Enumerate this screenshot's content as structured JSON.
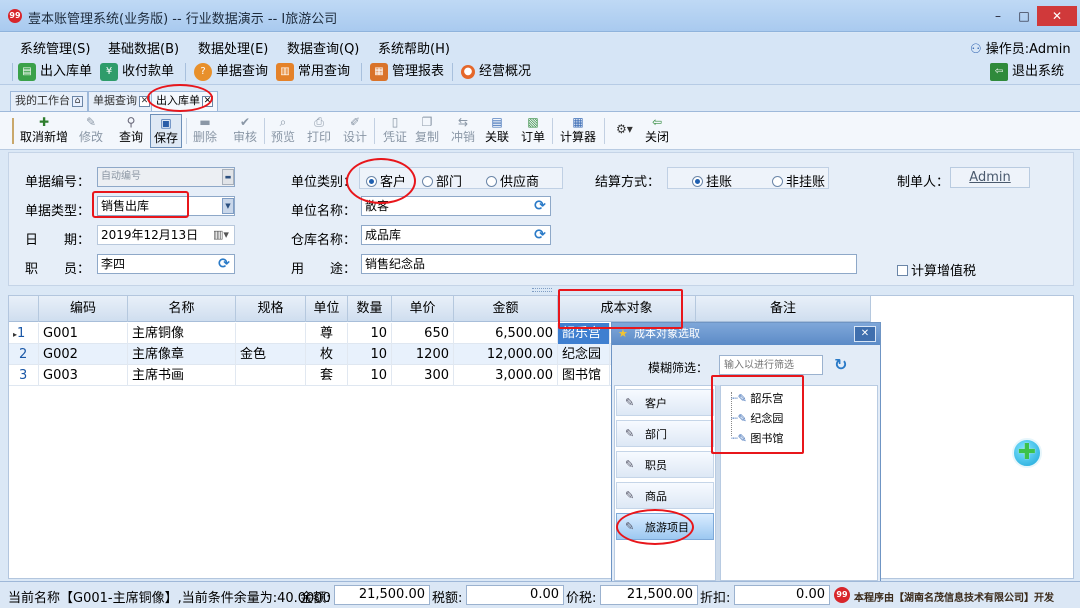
{
  "window": {
    "title": "壹本账管理系统(业务版) -- 行业数据演示 -- I旅游公司",
    "min_label": "–",
    "max_label": "□",
    "close_label": "✕"
  },
  "menu": {
    "items": [
      "系统管理(S)",
      "基础数据(B)",
      "数据处理(E)",
      "数据查询(Q)",
      "系统帮助(H)"
    ],
    "operator": "操作员:Admin"
  },
  "toolbar1": {
    "items": [
      "出入库单",
      "收付款单",
      "单据查询",
      "常用查询",
      "管理报表",
      "经营概况"
    ],
    "exit": "退出系统"
  },
  "tabs": [
    "我的工作台",
    "单据查询",
    "出入库单"
  ],
  "toolbar2": {
    "items": [
      "取消新增",
      "修改",
      "查询",
      "保存",
      "删除",
      "审核",
      "预览",
      "打印",
      "设计",
      "凭证",
      "复制",
      "冲销",
      "关联",
      "订单",
      "计算器",
      "",
      "关闭"
    ]
  },
  "form": {
    "doc_no_label": "单据编号：",
    "doc_no_placeholder": "自动编号",
    "doc_type_label": "单据类型：",
    "doc_type_value": "销售出库",
    "date_label": "日　　期：",
    "date_value": "2019年12月13日",
    "staff_label": "职　　员：",
    "staff_value": "李四",
    "unit_type_label": "单位类别：",
    "unit_types": [
      "客户",
      "部门",
      "供应商"
    ],
    "unit_name_label": "单位名称：",
    "unit_name_value": "散客",
    "warehouse_label": "仓库名称：",
    "warehouse_value": "成品库",
    "purpose_label": "用　　途：",
    "purpose_value": "销售纪念品",
    "settle_label": "结算方式：",
    "settle_options": [
      "挂账",
      "非挂账"
    ],
    "maker_label": "制单人：",
    "maker_value": "Admin",
    "vat_label": "计算增值税"
  },
  "grid": {
    "headers": [
      "编码",
      "名称",
      "规格",
      "单位",
      "数量",
      "单价",
      "金额",
      "成本对象",
      "备注"
    ],
    "rows": [
      {
        "no": "1",
        "code": "G001",
        "name": "主席铜像",
        "spec": "",
        "unit": "尊",
        "qty": "10",
        "price": "650",
        "amount": "6,500.00",
        "cost": "韶乐宫",
        "note": ""
      },
      {
        "no": "2",
        "code": "G002",
        "name": "主席像章",
        "spec": "金色",
        "unit": "枚",
        "qty": "10",
        "price": "1200",
        "amount": "12,000.00",
        "cost": "纪念园",
        "note": ""
      },
      {
        "no": "3",
        "code": "G003",
        "name": "主席书画",
        "spec": "",
        "unit": "套",
        "qty": "10",
        "price": "300",
        "amount": "3,000.00",
        "cost": "图书馆",
        "note": ""
      }
    ]
  },
  "popup": {
    "title": "成本对象选取",
    "filter_label": "模糊筛选：",
    "filter_placeholder": "输入以进行筛选",
    "categories": [
      "客户",
      "部门",
      "职员",
      "商品",
      "旅游项目"
    ],
    "tree": [
      "韶乐宫",
      "纪念园",
      "图书馆"
    ]
  },
  "status": {
    "current": "当前名称【G001-主席铜像】,当前条件余量为:40.0000",
    "amount_label": "金额:",
    "amount_value": "21,500.00",
    "tax_label": "税额:",
    "tax_value": "0.00",
    "price_tax_label": "价税:",
    "price_tax_value": "21,500.00",
    "discount_label": "折扣:",
    "discount_value": "0.00",
    "vendor": "本程序由【湖南名茂信息技术有限公司】开发"
  }
}
